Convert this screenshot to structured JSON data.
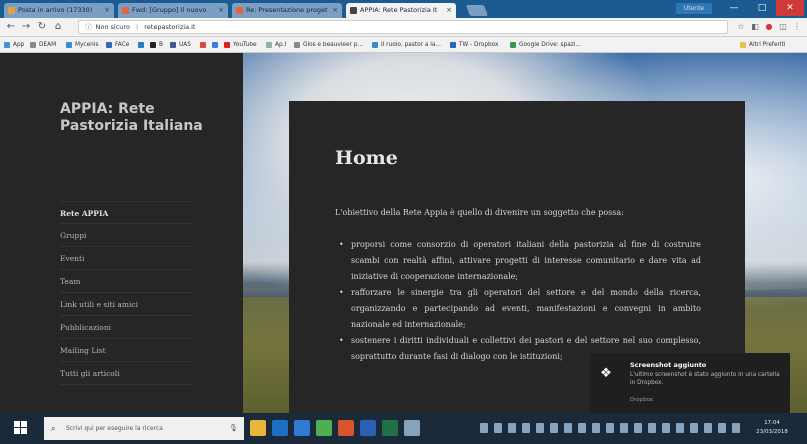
{
  "browser": {
    "tabs": [
      {
        "label": "Posta in arrivo (17330)"
      },
      {
        "label": "Fwd: [Gruppo] Il nuovo"
      },
      {
        "label": "Re: Presentazione proget"
      },
      {
        "label": "APPIA: Rete Pastorizia It",
        "active": true
      }
    ],
    "user": "Utente",
    "url": "retepastorizia.it",
    "url_prefix": "Non sicuro",
    "bookmarks": [
      {
        "label": "App",
        "color": "#4a90d9"
      },
      {
        "label": "DEAM",
        "color": "#8a8a8a"
      },
      {
        "label": "Mycenis",
        "color": "#3d8bd1"
      },
      {
        "label": "FACe",
        "color": "#3b67b0"
      },
      {
        "label": "",
        "color": "#2e78c9"
      },
      {
        "label": "B",
        "color": "#222222"
      },
      {
        "label": "UAS",
        "color": "#3b5998"
      },
      {
        "label": "",
        "color": "#d44"
      },
      {
        "label": "",
        "color": "#3d7ce0"
      },
      {
        "label": "YouTube",
        "color": "#e02020"
      },
      {
        "label": "Ap.I",
        "color": "#9aa"
      },
      {
        "label": "Glos e beauvieer p...",
        "color": "#888"
      },
      {
        "label": "Il ruolo, pastor a la...",
        "color": "#3c8bc6"
      },
      {
        "label": "TW - Dropbox",
        "color": "#2a64c2"
      },
      {
        "label": "Google Drive: spazi...",
        "color": "#2d9d52"
      },
      {
        "label": "Altri Preferiti",
        "color": "#e8c04b"
      }
    ]
  },
  "site": {
    "title": "APPIA: Rete Pastorizia Italiana",
    "menu": [
      {
        "label": "Rete APPIA",
        "current": true
      },
      {
        "label": "Gruppi"
      },
      {
        "label": "Eventi"
      },
      {
        "label": "Team"
      },
      {
        "label": "Link utili e siti amici"
      },
      {
        "label": "Pubblicazioni"
      },
      {
        "label": "Mailing List"
      },
      {
        "label": "Tutti gli articoli"
      }
    ]
  },
  "content": {
    "heading": "Home",
    "intro": "L'obiettivo della Rete Appia è quello di divenire un soggetto che possa:",
    "bullets": [
      "proporsi come consorzio di operatori italiani della pastorizia al fine di costruire scambi con realtà affini, attivare progetti di interesse comunitario e dare vita ad iniziative di cooperazione internazionale;",
      "rafforzare le sinergie tra gli operatori del settore e del mondo della ricerca, organizzando e partecipando ad eventi, manifestazioni e convegni in ambito nazionale ed internazionale;",
      "sostenere i diritti individuali e collettivi dei pastori e del settore nel suo complesso, soprattutto durante fasi di dialogo con le istituzioni;"
    ]
  },
  "toast": {
    "title": "Screenshot aggiunto",
    "body": "L'ultimo screenshot è stato aggiunto in una cartella in Dropbox.",
    "source": "Dropbox"
  },
  "taskbar": {
    "search_placeholder": "Scrivi qui per eseguire la ricerca",
    "time": "17:04",
    "date": "23/03/2018"
  }
}
